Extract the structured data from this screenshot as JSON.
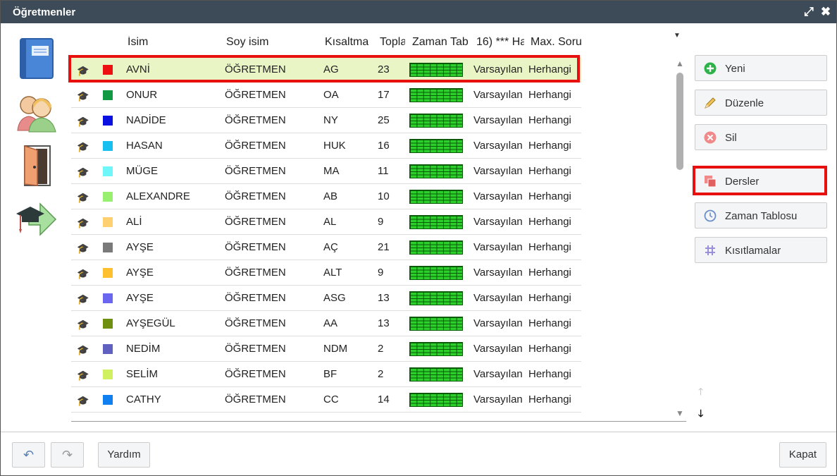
{
  "window": {
    "title": "Öğretmenler"
  },
  "table": {
    "columns": [
      "İsim",
      "Soy isim",
      "Kısaltma",
      "Topla",
      "Zaman Tab",
      "16) *** Ha",
      "Max. Soru"
    ],
    "rows": [
      {
        "color": "#ee1111",
        "name": "AVNİ",
        "surname": "ÖĞRETMEN",
        "short": "AG",
        "total": "23",
        "c6": "Varsayılan",
        "c7": "Herhangi"
      },
      {
        "color": "#119944",
        "name": "ONUR",
        "surname": "ÖĞRETMEN",
        "short": "OA",
        "total": "17",
        "c6": "Varsayılan",
        "c7": "Herhangi"
      },
      {
        "color": "#0a10e0",
        "name": "NADİDE",
        "surname": "ÖĞRETMEN",
        "short": "NY",
        "total": "25",
        "c6": "Varsayılan",
        "c7": "Herhangi"
      },
      {
        "color": "#17c0ef",
        "name": "HASAN",
        "surname": "ÖĞRETMEN",
        "short": "HUK",
        "total": "16",
        "c6": "Varsayılan",
        "c7": "Herhangi"
      },
      {
        "color": "#6ef6f8",
        "name": "MÜGE",
        "surname": "ÖĞRETMEN",
        "short": "MA",
        "total": "11",
        "c6": "Varsayılan",
        "c7": "Herhangi"
      },
      {
        "color": "#99f070",
        "name": "ALEXANDRE",
        "surname": "ÖĞRETMEN",
        "short": "AB",
        "total": "10",
        "c6": "Varsayılan",
        "c7": "Herhangi"
      },
      {
        "color": "#ffd070",
        "name": "ALİ",
        "surname": "ÖĞRETMEN",
        "short": "AL",
        "total": "9",
        "c6": "Varsayılan",
        "c7": "Herhangi"
      },
      {
        "color": "#7a7a7a",
        "name": "AYŞE",
        "surname": "ÖĞRETMEN",
        "short": "AÇ",
        "total": "21",
        "c6": "Varsayılan",
        "c7": "Herhangi"
      },
      {
        "color": "#ffc030",
        "name": "AYŞE",
        "surname": "ÖĞRETMEN",
        "short": "ALT",
        "total": "9",
        "c6": "Varsayılan",
        "c7": "Herhangi"
      },
      {
        "color": "#6b66f0",
        "name": "AYŞE",
        "surname": "ÖĞRETMEN",
        "short": "ASG",
        "total": "13",
        "c6": "Varsayılan",
        "c7": "Herhangi"
      },
      {
        "color": "#6f8f10",
        "name": "AYŞEGÜL",
        "surname": "ÖĞRETMEN",
        "short": "AA",
        "total": "13",
        "c6": "Varsayılan",
        "c7": "Herhangi"
      },
      {
        "color": "#6060c0",
        "name": "NEDİM",
        "surname": "ÖĞRETMEN",
        "short": "NDM",
        "total": "2",
        "c6": "Varsayılan",
        "c7": "Herhangi"
      },
      {
        "color": "#d0f060",
        "name": "SELİM",
        "surname": "ÖĞRETMEN",
        "short": "BF",
        "total": "2",
        "c6": "Varsayılan",
        "c7": "Herhangi"
      },
      {
        "color": "#1080f0",
        "name": "CATHY",
        "surname": "ÖĞRETMEN",
        "short": "CC",
        "total": "14",
        "c6": "Varsayılan",
        "c7": "Herhangi"
      }
    ]
  },
  "actions": {
    "new": "Yeni",
    "edit": "Düzenle",
    "delete": "Sil",
    "lessons": "Dersler",
    "timetable": "Zaman Tablosu",
    "constraints": "Kısıtlamalar"
  },
  "footer": {
    "help": "Yardım",
    "close": "Kapat"
  },
  "colors": {
    "titlebar": "#3d4a57",
    "highlight": "#e8100f",
    "selected_row": "#eaf5c6",
    "timetable_green": "#2bd02b"
  }
}
